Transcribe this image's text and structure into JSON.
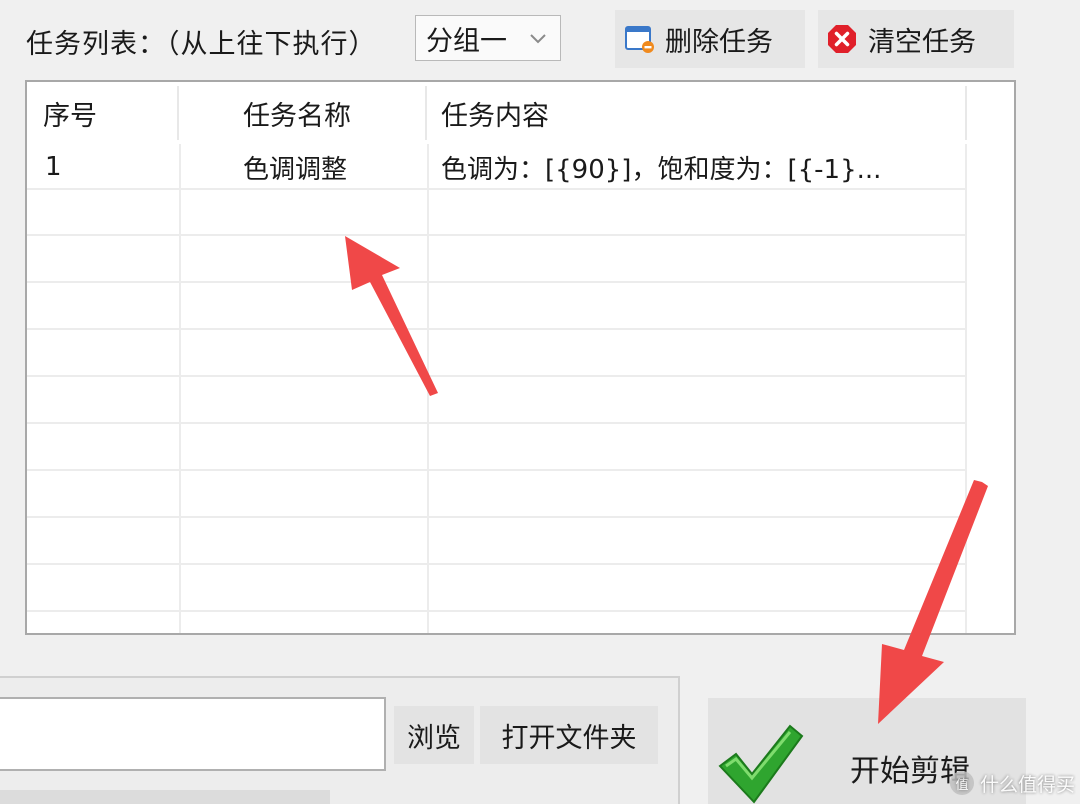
{
  "toolbar": {
    "list_label": "任务列表：（从上往下执行）",
    "group_select": {
      "selected": "分组一"
    },
    "delete_task_label": "删除任务",
    "clear_tasks_label": "清空任务"
  },
  "task_table": {
    "columns": [
      "序号",
      "任务名称",
      "任务内容"
    ],
    "rows": [
      {
        "index": "1",
        "name": "色调调整",
        "content": "色调为：[{90}]，饱和度为：[{-1}..."
      }
    ]
  },
  "output": {
    "path_value": "",
    "browse_label": "浏览",
    "open_folder_label": "打开文件夹"
  },
  "start_button": {
    "label": "开始剪辑"
  },
  "watermark": {
    "text": "什么值得买",
    "badge": "值"
  },
  "colors": {
    "arrow_red": "#f04848",
    "check_green": "#2fa52f",
    "clear_icon_red": "#e0202a"
  }
}
